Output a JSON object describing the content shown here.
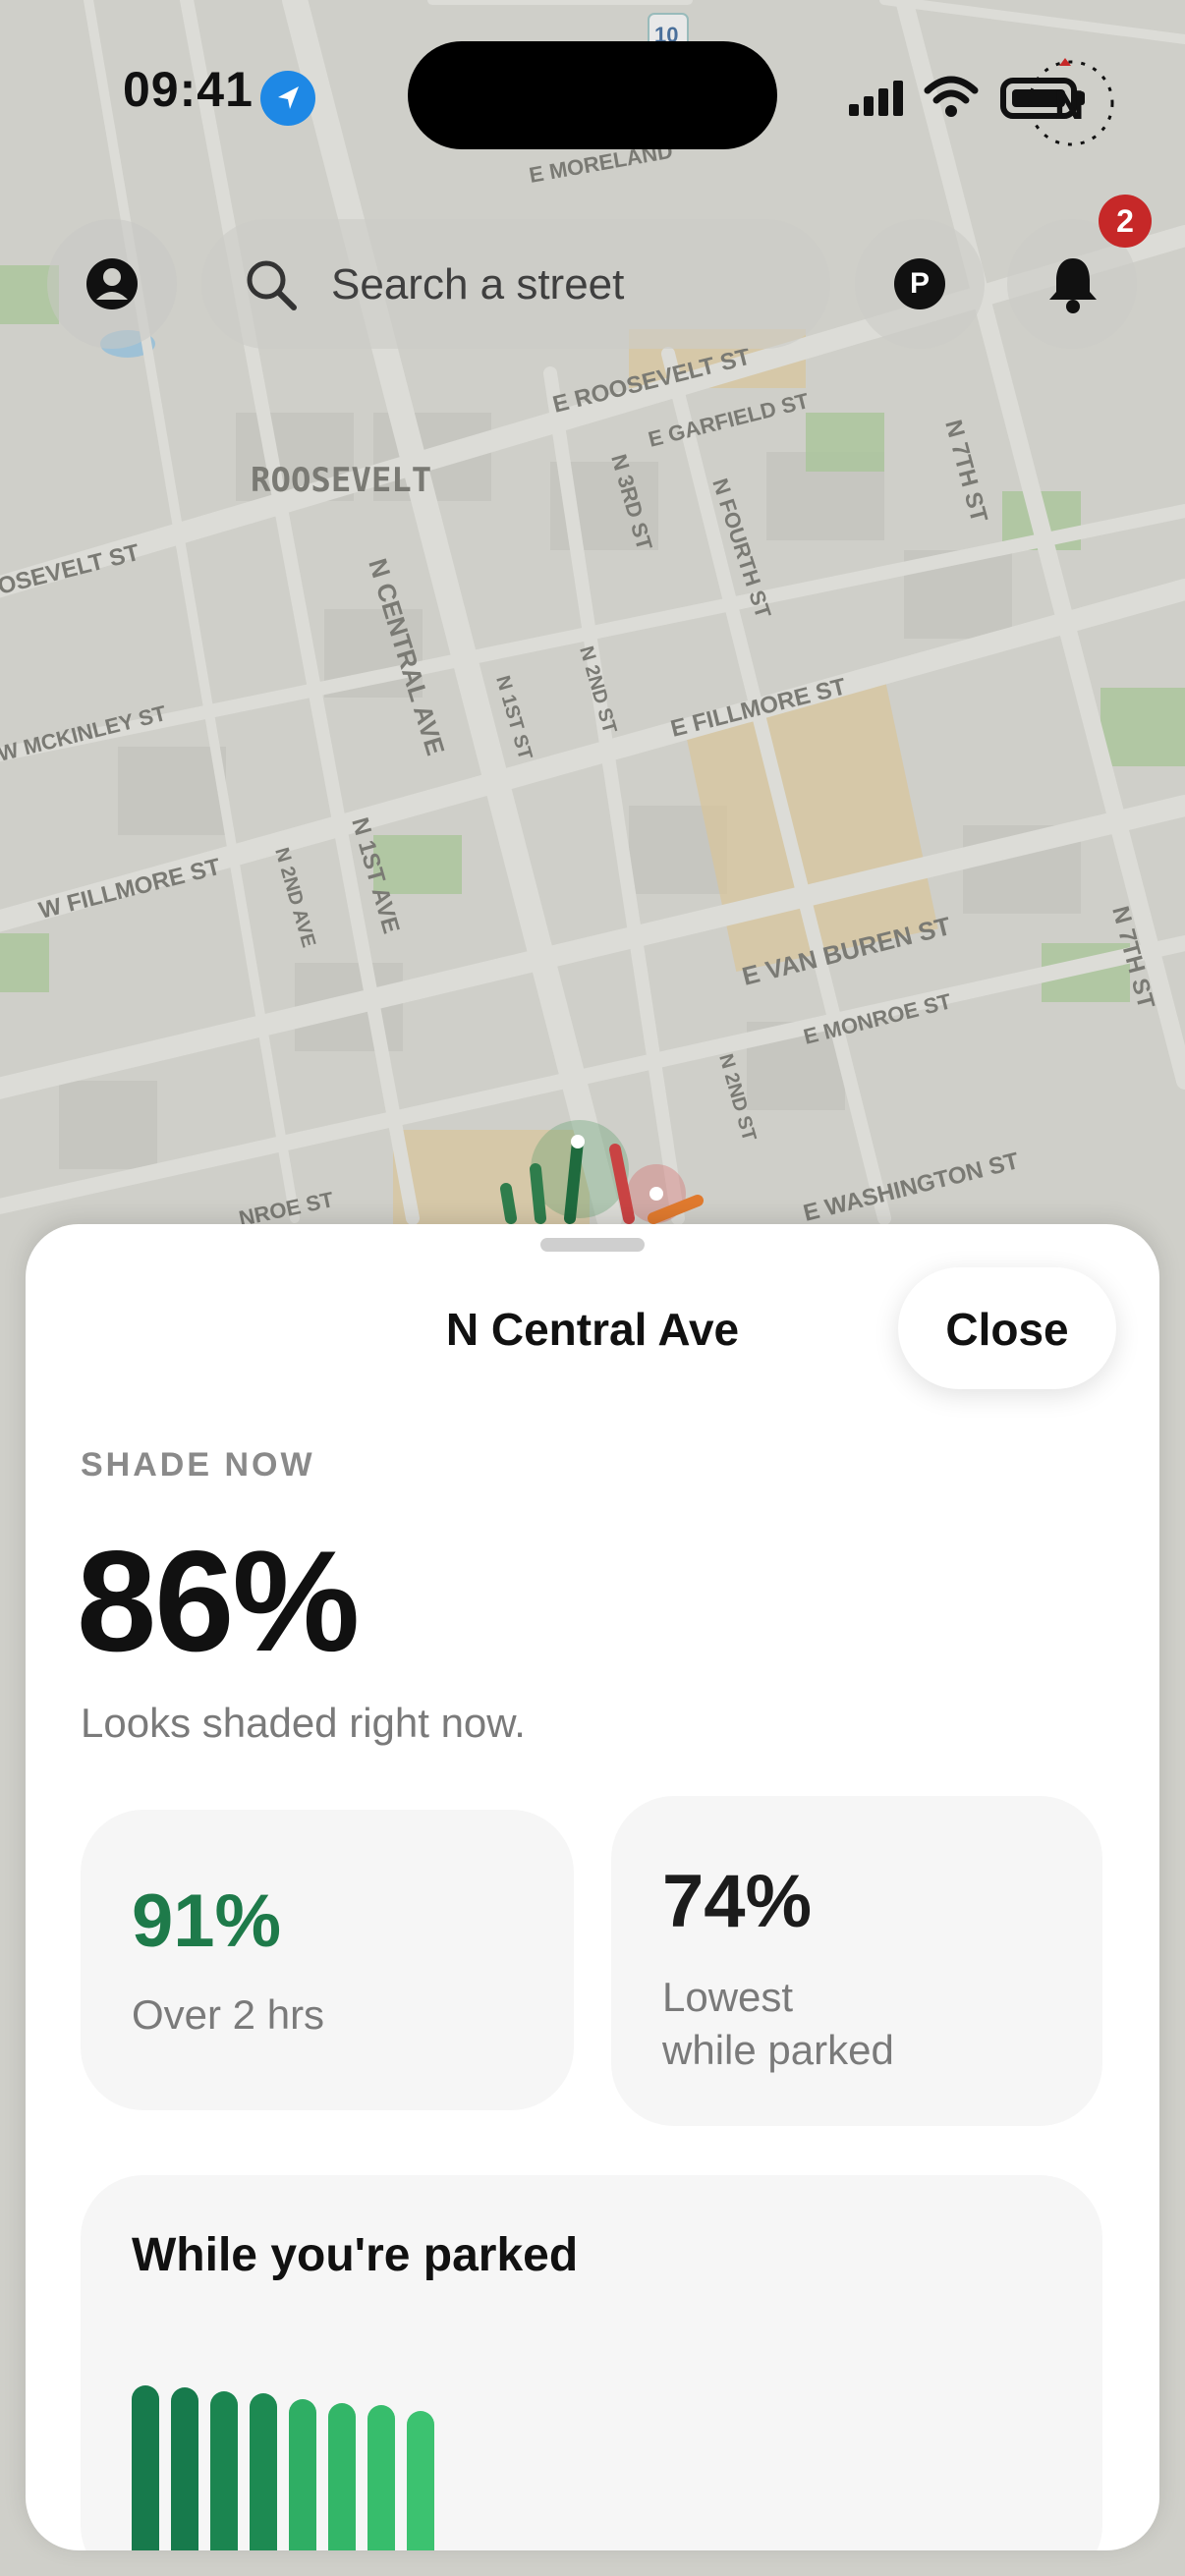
{
  "status_bar": {
    "time": "09:41",
    "location_icon": "location-arrow-icon",
    "signal_icon": "cellular-signal-icon",
    "wifi_icon": "wifi-icon",
    "battery_icon": "battery-icon"
  },
  "map": {
    "compass_label": "N",
    "labels": {
      "interstate": "10",
      "e_moreland": "E MORELAND",
      "e_roosevelt": "E ROOSEVELT ST",
      "roosevelt": "ROOSEVELT",
      "roosevelt_st": "OSEVELT ST",
      "e_garfield": "E GARFIELD ST",
      "n_3rd": "N 3RD ST",
      "n_fourth": "N FOURTH ST",
      "n_7th": "N 7TH ST",
      "n_central": "N CENTRAL AVE",
      "w_mckinley": "W MCKINLEY ST",
      "n_1st_st": "N 1ST ST",
      "n_2nd_st": "N 2ND ST",
      "e_fillmore": "E FILLMORE ST",
      "w_fillmore": "W FILLMORE ST",
      "n_2nd_ave": "N 2ND AVE",
      "n_1st_ave": "N 1ST AVE",
      "e_van_buren": "E VAN BUREN ST",
      "e_monroe": "E MONROE ST",
      "n_2nd_st_b": "N 2ND ST",
      "n_7th_b": "N 7TH ST",
      "monroe_st": "NROE ST",
      "e_washington": "E WASHINGTON ST"
    }
  },
  "topbar": {
    "profile_icon": "person-circle-icon",
    "search_icon": "magnifier-icon",
    "search_placeholder": "Search a street",
    "parking_label": "P",
    "bell_icon": "bell-icon",
    "notification_count": "2"
  },
  "sheet": {
    "title": "N Central Ave",
    "close_label": "Close",
    "shade_label": "SHADE NOW",
    "shade_value": "86%",
    "shade_description": "Looks shaded right now.",
    "stats": [
      {
        "value": "91%",
        "label": "Over 2 hrs",
        "color": "#1e7a4a"
      },
      {
        "value": "74%",
        "label": "Lowest\nwhile parked",
        "color": "#1c1c1c"
      }
    ],
    "parked_title": "While you're parked"
  },
  "chart_data": {
    "type": "bar",
    "values": [
      96,
      95,
      93,
      92,
      89,
      87,
      86,
      83
    ],
    "colors": [
      "#177a4c",
      "#177a4c",
      "#1b8550",
      "#1d8a52",
      "#2fae64",
      "#33b668",
      "#37bd6c",
      "#3cc270"
    ]
  }
}
